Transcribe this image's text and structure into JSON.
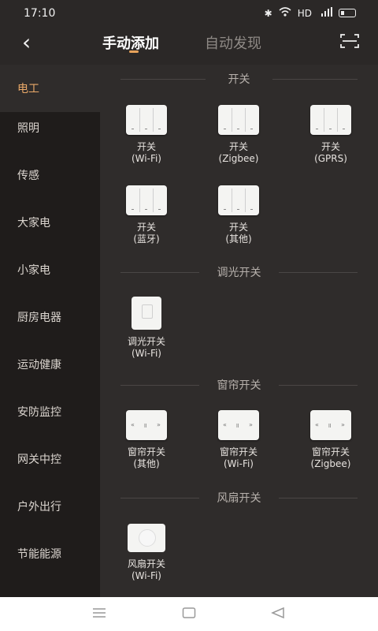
{
  "status_bar": {
    "time": "17:10",
    "indicators": [
      "bluetooth-icon",
      "wifi-icon",
      "HD",
      "4G signal",
      "battery"
    ],
    "hd_label": "HD"
  },
  "nav": {
    "back_icon": "back-arrow-icon",
    "tabs": [
      {
        "label": "手动添加",
        "active": true
      },
      {
        "label": "自动发现",
        "active": false
      }
    ],
    "scan_icon": "scan-icon"
  },
  "sidebar": {
    "items": [
      {
        "label": "电工",
        "active": true
      },
      {
        "label": "照明",
        "active": false
      },
      {
        "label": "传感",
        "active": false
      },
      {
        "label": "大家电",
        "active": false
      },
      {
        "label": "小家电",
        "active": false
      },
      {
        "label": "厨房电器",
        "active": false
      },
      {
        "label": "运动健康",
        "active": false
      },
      {
        "label": "安防监控",
        "active": false
      },
      {
        "label": "网关中控",
        "active": false
      },
      {
        "label": "户外出行",
        "active": false
      },
      {
        "label": "节能能源",
        "active": false
      }
    ]
  },
  "sections": [
    {
      "title": "开关",
      "devices": [
        {
          "name": "开关",
          "sub": "(Wi-Fi)"
        },
        {
          "name": "开关",
          "sub": "(Zigbee)"
        },
        {
          "name": "开关",
          "sub": "(GPRS)"
        },
        {
          "name": "开关",
          "sub": "(蓝牙)"
        },
        {
          "name": "开关",
          "sub": "(其他)"
        }
      ]
    },
    {
      "title": "调光开关",
      "devices": [
        {
          "name": "调光开关",
          "sub": "(Wi-Fi)"
        }
      ]
    },
    {
      "title": "窗帘开关",
      "devices": [
        {
          "name": "窗帘开关",
          "sub": "(其他)"
        },
        {
          "name": "窗帘开关",
          "sub": "(Wi-Fi)"
        },
        {
          "name": "窗帘开关",
          "sub": "(Zigbee)"
        }
      ]
    },
    {
      "title": "风扇开关",
      "devices": [
        {
          "name": "风扇开关",
          "sub": "(Wi-Fi)"
        }
      ]
    }
  ],
  "curtain_icon_text": [
    "«",
    "॥",
    "»"
  ],
  "bottom_nav": {
    "icons": [
      "menu-icon",
      "home-icon",
      "back-triangle-icon"
    ]
  },
  "colors": {
    "accent": "#e9a868",
    "sidebar_bg": "#1f1c1b",
    "content_bg": "#2f2c2b"
  }
}
